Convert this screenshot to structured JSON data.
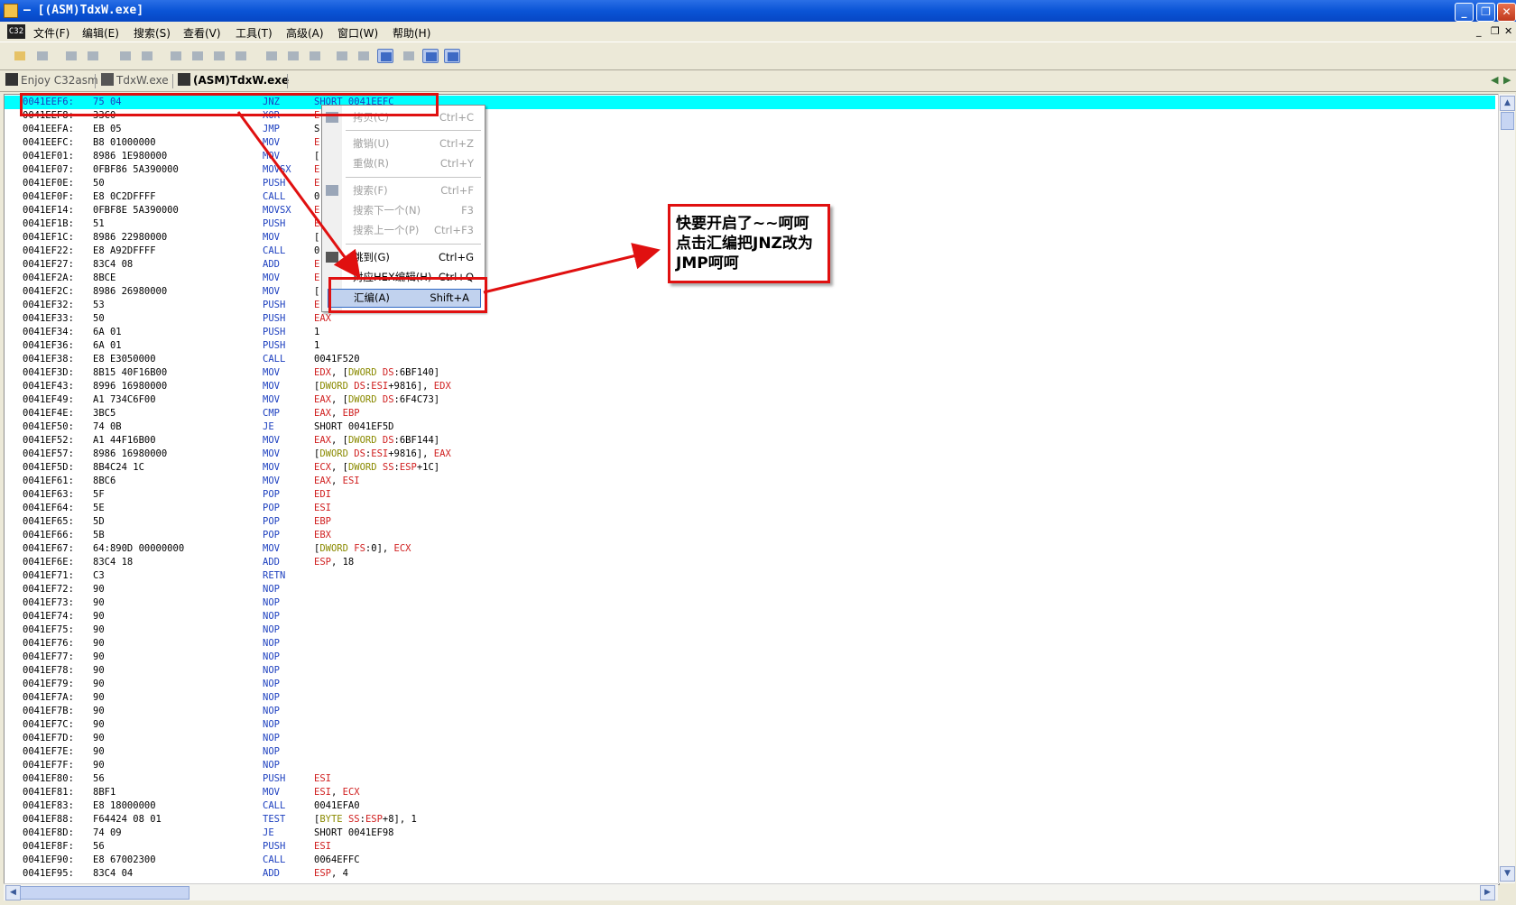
{
  "window": {
    "title": "– [(ASM)TdxW.exe]"
  },
  "menubar": {
    "logo": "C32",
    "items": [
      "文件(F)",
      "编辑(E)",
      "搜索(S)",
      "查看(V)",
      "工具(T)",
      "高级(A)",
      "窗口(W)",
      "帮助(H)"
    ]
  },
  "tabs": [
    {
      "label": "Enjoy C32asm"
    },
    {
      "label": "TdxW.exe"
    },
    {
      "label": "(ASM)TdxW.exe"
    }
  ],
  "disasm": [
    {
      "addr": "0041EEF6:",
      "hex": "75 04",
      "mn": "JNZ",
      "op": [
        [
          "SHORT 0041EEFC",
          "n"
        ]
      ]
    },
    {
      "addr": "0041EEF8:",
      "hex": "33C0",
      "mn": "XOR",
      "op": [
        [
          "E",
          "r"
        ]
      ]
    },
    {
      "addr": "0041EEFA:",
      "hex": "EB 05",
      "mn": "JMP",
      "op": [
        [
          "S",
          "n"
        ]
      ]
    },
    {
      "addr": "0041EEFC:",
      "hex": "B8 01000000",
      "mn": "MOV",
      "op": [
        [
          "E",
          "r"
        ]
      ]
    },
    {
      "addr": "0041EF01:",
      "hex": "8986 1E980000",
      "mn": "MOV",
      "op": [
        [
          "[",
          "n"
        ]
      ]
    },
    {
      "addr": "0041EF07:",
      "hex": "0FBF86 5A390000",
      "mn": "MOVSX",
      "op": [
        [
          "E",
          "r"
        ]
      ]
    },
    {
      "addr": "0041EF0E:",
      "hex": "50",
      "mn": "PUSH",
      "op": [
        [
          "E",
          "r"
        ]
      ]
    },
    {
      "addr": "0041EF0F:",
      "hex": "E8 0C2DFFFF",
      "mn": "CALL",
      "op": [
        [
          "0",
          "n"
        ]
      ]
    },
    {
      "addr": "0041EF14:",
      "hex": "0FBF8E 5A390000",
      "mn": "MOVSX",
      "op": [
        [
          "E",
          "r"
        ]
      ]
    },
    {
      "addr": "0041EF1B:",
      "hex": "51",
      "mn": "PUSH",
      "op": [
        [
          "E",
          "r"
        ]
      ]
    },
    {
      "addr": "0041EF1C:",
      "hex": "8986 22980000",
      "mn": "MOV",
      "op": [
        [
          "[",
          "n"
        ]
      ]
    },
    {
      "addr": "0041EF22:",
      "hex": "E8 A92DFFFF",
      "mn": "CALL",
      "op": [
        [
          "0",
          "n"
        ]
      ]
    },
    {
      "addr": "0041EF27:",
      "hex": "83C4 08",
      "mn": "ADD",
      "op": [
        [
          "E",
          "r"
        ]
      ]
    },
    {
      "addr": "0041EF2A:",
      "hex": "8BCE",
      "mn": "MOV",
      "op": [
        [
          "E",
          "r"
        ]
      ]
    },
    {
      "addr": "0041EF2C:",
      "hex": "8986 26980000",
      "mn": "MOV",
      "op": [
        [
          "[",
          "n"
        ]
      ]
    },
    {
      "addr": "0041EF32:",
      "hex": "53",
      "mn": "PUSH",
      "op": [
        [
          "E",
          "r"
        ]
      ]
    },
    {
      "addr": "0041EF33:",
      "hex": "50",
      "mn": "PUSH",
      "op": [
        [
          "EAX",
          "r"
        ]
      ]
    },
    {
      "addr": "0041EF34:",
      "hex": "6A 01",
      "mn": "PUSH",
      "op": [
        [
          "1",
          "n"
        ]
      ]
    },
    {
      "addr": "0041EF36:",
      "hex": "6A 01",
      "mn": "PUSH",
      "op": [
        [
          "1",
          "n"
        ]
      ]
    },
    {
      "addr": "0041EF38:",
      "hex": "E8 E3050000",
      "mn": "CALL",
      "op": [
        [
          "0041F520",
          "n"
        ]
      ]
    },
    {
      "addr": "0041EF3D:",
      "hex": "8B15 40F16B00",
      "mn": "MOV",
      "op": [
        [
          "EDX",
          "r"
        ],
        [
          ", [",
          "n"
        ],
        [
          "DWORD",
          "g"
        ],
        [
          " ",
          "n"
        ],
        [
          "DS",
          "r"
        ],
        [
          ":6BF140]",
          "n"
        ]
      ]
    },
    {
      "addr": "0041EF43:",
      "hex": "8996 16980000",
      "mn": "MOV",
      "op": [
        [
          "[",
          "n"
        ],
        [
          "DWORD",
          "g"
        ],
        [
          " ",
          "n"
        ],
        [
          "DS",
          "r"
        ],
        [
          ":",
          "n"
        ],
        [
          "ESI",
          "r"
        ],
        [
          "+9816], ",
          "n"
        ],
        [
          "EDX",
          "r"
        ]
      ]
    },
    {
      "addr": "0041EF49:",
      "hex": "A1 734C6F00",
      "mn": "MOV",
      "op": [
        [
          "EAX",
          "r"
        ],
        [
          ", [",
          "n"
        ],
        [
          "DWORD",
          "g"
        ],
        [
          " ",
          "n"
        ],
        [
          "DS",
          "r"
        ],
        [
          ":6F4C73]",
          "n"
        ]
      ]
    },
    {
      "addr": "0041EF4E:",
      "hex": "3BC5",
      "mn": "CMP",
      "op": [
        [
          "EAX",
          "r"
        ],
        [
          ", ",
          "n"
        ],
        [
          "EBP",
          "r"
        ]
      ]
    },
    {
      "addr": "0041EF50:",
      "hex": "74 0B",
      "mn": "JE",
      "op": [
        [
          "SHORT 0041EF5D",
          "n"
        ]
      ]
    },
    {
      "addr": "0041EF52:",
      "hex": "A1 44F16B00",
      "mn": "MOV",
      "op": [
        [
          "EAX",
          "r"
        ],
        [
          ", [",
          "n"
        ],
        [
          "DWORD",
          "g"
        ],
        [
          " ",
          "n"
        ],
        [
          "DS",
          "r"
        ],
        [
          ":6BF144]",
          "n"
        ]
      ]
    },
    {
      "addr": "0041EF57:",
      "hex": "8986 16980000",
      "mn": "MOV",
      "op": [
        [
          "[",
          "n"
        ],
        [
          "DWORD",
          "g"
        ],
        [
          " ",
          "n"
        ],
        [
          "DS",
          "r"
        ],
        [
          ":",
          "n"
        ],
        [
          "ESI",
          "r"
        ],
        [
          "+9816], ",
          "n"
        ],
        [
          "EAX",
          "r"
        ]
      ]
    },
    {
      "addr": "0041EF5D:",
      "hex": "8B4C24 1C",
      "mn": "MOV",
      "op": [
        [
          "ECX",
          "r"
        ],
        [
          ", [",
          "n"
        ],
        [
          "DWORD",
          "g"
        ],
        [
          " ",
          "n"
        ],
        [
          "SS",
          "r"
        ],
        [
          ":",
          "n"
        ],
        [
          "ESP",
          "r"
        ],
        [
          "+1C]",
          "n"
        ]
      ]
    },
    {
      "addr": "0041EF61:",
      "hex": "8BC6",
      "mn": "MOV",
      "op": [
        [
          "EAX",
          "r"
        ],
        [
          ", ",
          "n"
        ],
        [
          "ESI",
          "r"
        ]
      ]
    },
    {
      "addr": "0041EF63:",
      "hex": "5F",
      "mn": "POP",
      "op": [
        [
          "EDI",
          "r"
        ]
      ]
    },
    {
      "addr": "0041EF64:",
      "hex": "5E",
      "mn": "POP",
      "op": [
        [
          "ESI",
          "r"
        ]
      ]
    },
    {
      "addr": "0041EF65:",
      "hex": "5D",
      "mn": "POP",
      "op": [
        [
          "EBP",
          "r"
        ]
      ]
    },
    {
      "addr": "0041EF66:",
      "hex": "5B",
      "mn": "POP",
      "op": [
        [
          "EBX",
          "r"
        ]
      ]
    },
    {
      "addr": "0041EF67:",
      "hex": "64:890D 00000000",
      "mn": "MOV",
      "op": [
        [
          "[",
          "n"
        ],
        [
          "DWORD",
          "g"
        ],
        [
          " ",
          "n"
        ],
        [
          "FS",
          "r"
        ],
        [
          ":0], ",
          "n"
        ],
        [
          "ECX",
          "r"
        ]
      ]
    },
    {
      "addr": "0041EF6E:",
      "hex": "83C4 18",
      "mn": "ADD",
      "op": [
        [
          "ESP",
          "r"
        ],
        [
          ", 18",
          "n"
        ]
      ]
    },
    {
      "addr": "0041EF71:",
      "hex": "C3",
      "mn": "RETN",
      "op": []
    },
    {
      "addr": "0041EF72:",
      "hex": "90",
      "mn": "NOP",
      "op": []
    },
    {
      "addr": "0041EF73:",
      "hex": "90",
      "mn": "NOP",
      "op": []
    },
    {
      "addr": "0041EF74:",
      "hex": "90",
      "mn": "NOP",
      "op": []
    },
    {
      "addr": "0041EF75:",
      "hex": "90",
      "mn": "NOP",
      "op": []
    },
    {
      "addr": "0041EF76:",
      "hex": "90",
      "mn": "NOP",
      "op": []
    },
    {
      "addr": "0041EF77:",
      "hex": "90",
      "mn": "NOP",
      "op": []
    },
    {
      "addr": "0041EF78:",
      "hex": "90",
      "mn": "NOP",
      "op": []
    },
    {
      "addr": "0041EF79:",
      "hex": "90",
      "mn": "NOP",
      "op": []
    },
    {
      "addr": "0041EF7A:",
      "hex": "90",
      "mn": "NOP",
      "op": []
    },
    {
      "addr": "0041EF7B:",
      "hex": "90",
      "mn": "NOP",
      "op": []
    },
    {
      "addr": "0041EF7C:",
      "hex": "90",
      "mn": "NOP",
      "op": []
    },
    {
      "addr": "0041EF7D:",
      "hex": "90",
      "mn": "NOP",
      "op": []
    },
    {
      "addr": "0041EF7E:",
      "hex": "90",
      "mn": "NOP",
      "op": []
    },
    {
      "addr": "0041EF7F:",
      "hex": "90",
      "mn": "NOP",
      "op": []
    },
    {
      "addr": "0041EF80:",
      "hex": "56",
      "mn": "PUSH",
      "op": [
        [
          "ESI",
          "r"
        ]
      ]
    },
    {
      "addr": "0041EF81:",
      "hex": "8BF1",
      "mn": "MOV",
      "op": [
        [
          "ESI",
          "r"
        ],
        [
          ", ",
          "n"
        ],
        [
          "ECX",
          "r"
        ]
      ]
    },
    {
      "addr": "0041EF83:",
      "hex": "E8 18000000",
      "mn": "CALL",
      "op": [
        [
          "0041EFA0",
          "n"
        ]
      ]
    },
    {
      "addr": "0041EF88:",
      "hex": "F64424 08 01",
      "mn": "TEST",
      "op": [
        [
          "[",
          "n"
        ],
        [
          "BYTE",
          "g"
        ],
        [
          " ",
          "n"
        ],
        [
          "SS",
          "r"
        ],
        [
          ":",
          "n"
        ],
        [
          "ESP",
          "r"
        ],
        [
          "+8], 1",
          "n"
        ]
      ]
    },
    {
      "addr": "0041EF8D:",
      "hex": "74 09",
      "mn": "JE",
      "op": [
        [
          "SHORT 0041EF98",
          "n"
        ]
      ]
    },
    {
      "addr": "0041EF8F:",
      "hex": "56",
      "mn": "PUSH",
      "op": [
        [
          "ESI",
          "r"
        ]
      ]
    },
    {
      "addr": "0041EF90:",
      "hex": "E8 67002300",
      "mn": "CALL",
      "op": [
        [
          "0064EFFC",
          "n"
        ]
      ]
    },
    {
      "addr": "0041EF95:",
      "hex": "83C4 04",
      "mn": "ADD",
      "op": [
        [
          "ESP",
          "r"
        ],
        [
          ", 4",
          "n"
        ]
      ]
    }
  ],
  "context_menu": {
    "items": [
      {
        "label": "拷贝(C)",
        "shortcut": "Ctrl+C"
      },
      {
        "label": "撤销(U)",
        "shortcut": "Ctrl+Z"
      },
      {
        "label": "重做(R)",
        "shortcut": "Ctrl+Y"
      },
      {
        "label": "搜索(F)",
        "shortcut": "Ctrl+F"
      },
      {
        "label": "搜索下一个(N)",
        "shortcut": "F3"
      },
      {
        "label": "搜索上一个(P)",
        "shortcut": "Ctrl+F3"
      },
      {
        "label": "跳到(G)",
        "shortcut": "Ctrl+G"
      },
      {
        "label": "对应HEX编辑(H)",
        "shortcut": "Ctrl+Q"
      },
      {
        "label": "汇编(A)",
        "shortcut": "Shift+A"
      }
    ]
  },
  "callout": {
    "text": "快要开启了~~呵呵点击汇编把JNZ改为JMP呵呵"
  },
  "colors": {
    "highlight": "#00ffff",
    "annotation": "#e01010",
    "mnemonic": "#1c3fbf",
    "register": "#d02020",
    "size": "#8a8a00"
  }
}
